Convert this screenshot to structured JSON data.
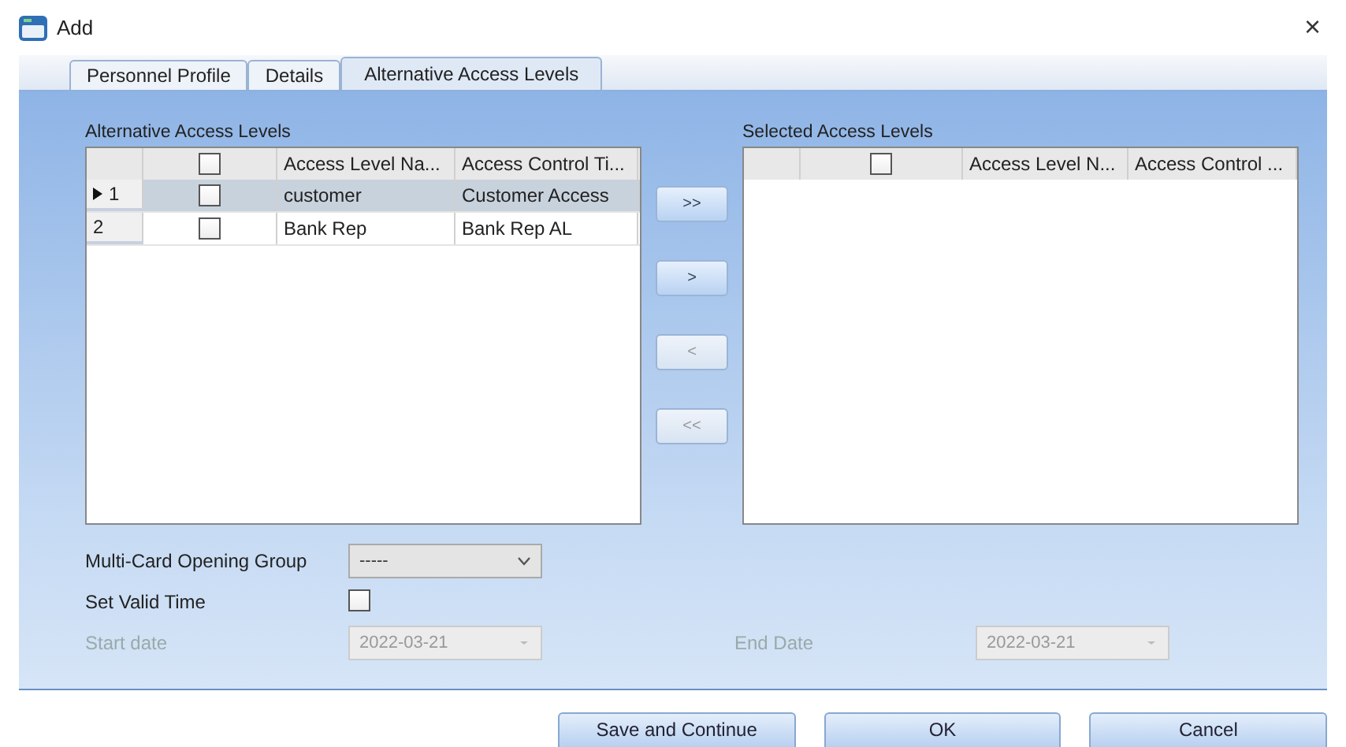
{
  "window": {
    "title": "Add",
    "close": "×"
  },
  "tabs": [
    {
      "label": "Personnel Profile",
      "selected": false
    },
    {
      "label": "Details",
      "selected": false
    },
    {
      "label": "Alternative  Access  Levels",
      "selected": true
    }
  ],
  "available": {
    "title": "Alternative Access Levels",
    "header_checked": false,
    "columns": [
      "Access Level Na...",
      "Access Control Ti..."
    ],
    "rows": [
      {
        "number": "1",
        "selected": true,
        "checked": false,
        "name": "customer",
        "control": "Customer Access"
      },
      {
        "number": "2",
        "selected": false,
        "checked": false,
        "name": "Bank Rep",
        "control": "Bank Rep AL"
      }
    ]
  },
  "move_buttons": [
    {
      "label": ">>",
      "disabled": false
    },
    {
      "label": ">",
      "disabled": false
    },
    {
      "label": "<",
      "disabled": true
    },
    {
      "label": "<<",
      "disabled": true
    }
  ],
  "selected_levels": {
    "title": "Selected Access Levels",
    "header_checked": false,
    "columns": [
      "Access Level N...",
      "Access Control ..."
    ]
  },
  "multi_card": {
    "label": "Multi-Card Opening Group",
    "value": "-----"
  },
  "valid_time": {
    "label": "Set Valid Time",
    "checked": false
  },
  "start_date": {
    "label": "Start date",
    "value": "2022-03-21",
    "disabled": true
  },
  "end_date": {
    "label": "End Date",
    "value": "2022-03-21",
    "disabled": true
  },
  "buttons": [
    "Save and Continue",
    "OK",
    "Cancel"
  ]
}
